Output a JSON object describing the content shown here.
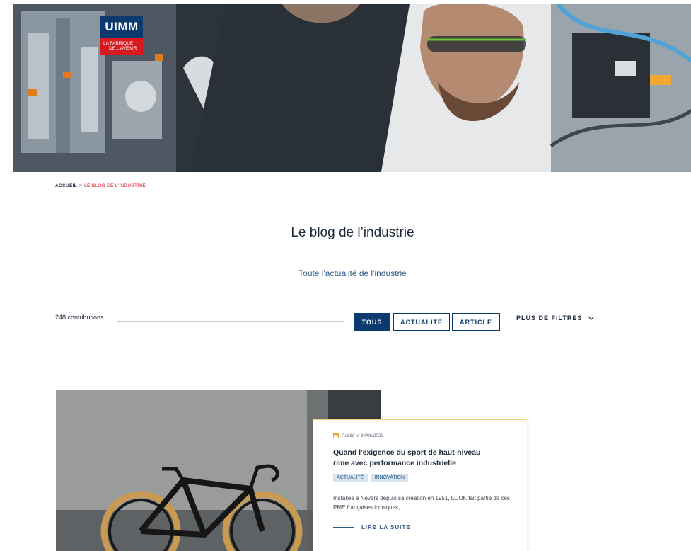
{
  "logo": {
    "brand": "UIMM",
    "tagline_line1": "La Fabrique",
    "tagline_line2": "de l'Avenir"
  },
  "breadcrumb": {
    "home": "Accueil",
    "separator": ">",
    "current": "Le blog de l'industrie"
  },
  "page": {
    "title": "Le blog de l’industrie",
    "subtitle": "Toute l'actualité de l'industrie"
  },
  "filters": {
    "count": "248 contributions",
    "buttons": [
      {
        "label": "Tous",
        "active": true
      },
      {
        "label": "Actualité",
        "active": false
      },
      {
        "label": "Article",
        "active": false
      }
    ],
    "more": "Plus de filtres"
  },
  "card": {
    "date": "Publié le 30/06/2023",
    "title": "Quand l'exigence du sport de haut-niveau rime avec performance industrielle",
    "tags": [
      "Actualité",
      "Innovation"
    ],
    "excerpt": "Installée à Nevers depuis sa création en 1951, LOOK fait partie de ces PME françaises iconiques,...",
    "read_more": "Lire la suite",
    "bike_brand": "LOOK"
  },
  "colors": {
    "navy": "#0b3a6e",
    "red": "#d71920",
    "accent_yellow": "#f3d37a",
    "tag_bg": "#d7e4ef"
  }
}
